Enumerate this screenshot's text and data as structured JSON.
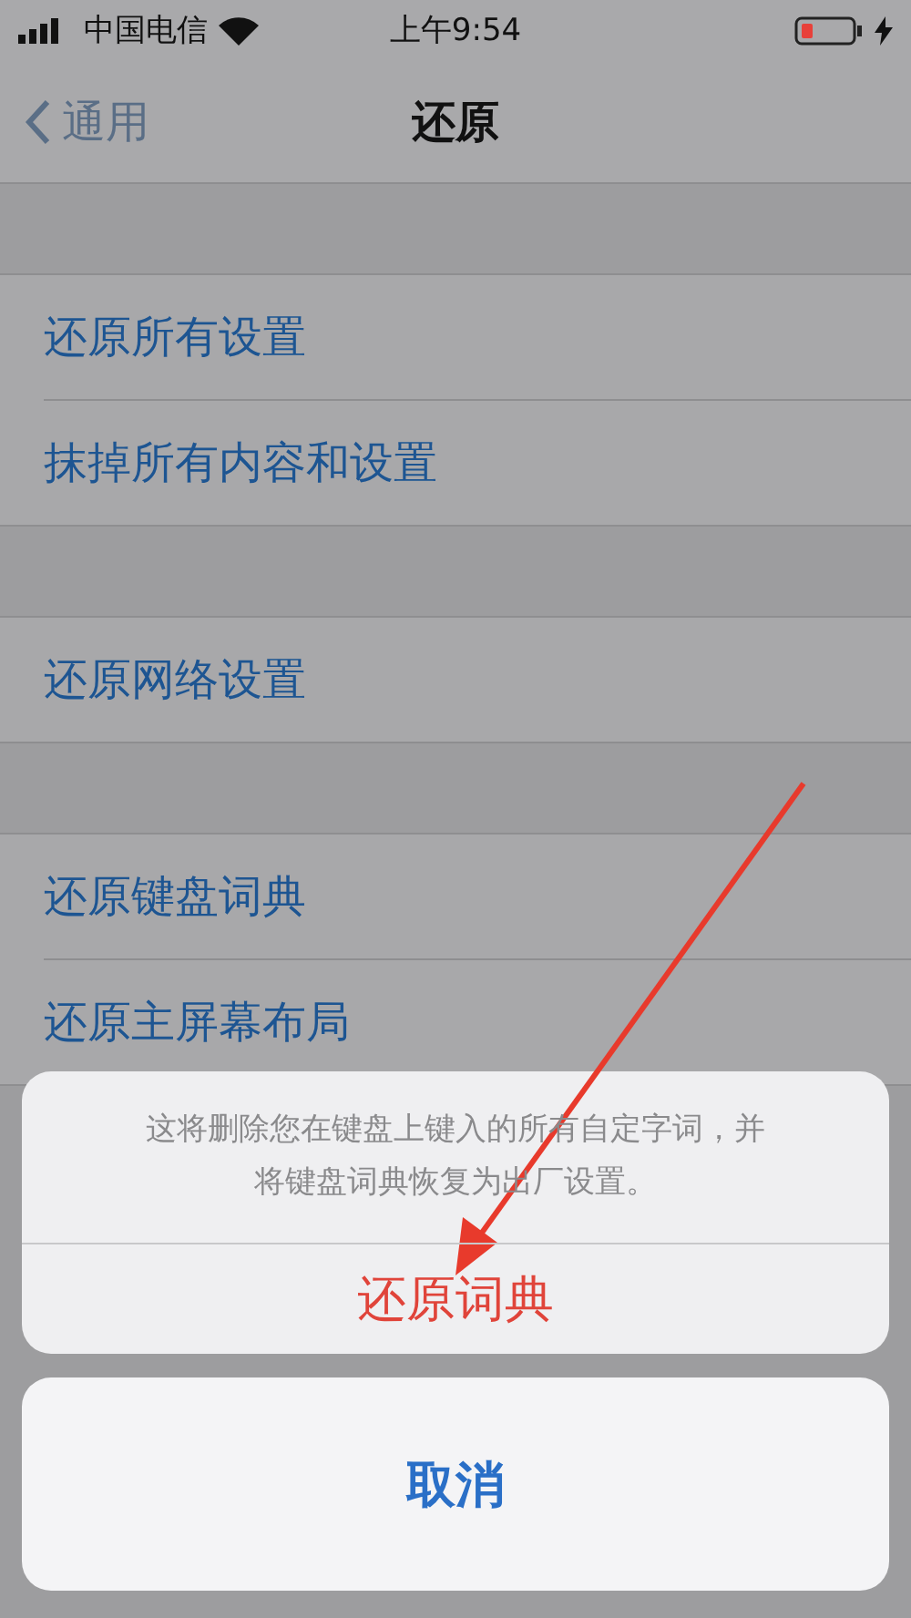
{
  "status_bar": {
    "carrier": "中国电信",
    "time": "上午9:54",
    "battery_low": true,
    "charging": true
  },
  "nav": {
    "back": "通用",
    "title": "还原"
  },
  "groups": [
    {
      "rows": [
        "还原所有设置",
        "抹掉所有内容和设置"
      ]
    },
    {
      "rows": [
        "还原网络设置"
      ]
    },
    {
      "rows": [
        "还原键盘词典",
        "还原主屏幕布局"
      ]
    }
  ],
  "action_sheet": {
    "message": "这将删除您在键盘上键入的所有自定字词，并将键盘词典恢复为出厂设置。",
    "actions": [
      {
        "label": "还原词典",
        "kind": "destructive"
      }
    ],
    "cancel": "取消"
  },
  "annotation": {
    "kind": "arrow"
  }
}
